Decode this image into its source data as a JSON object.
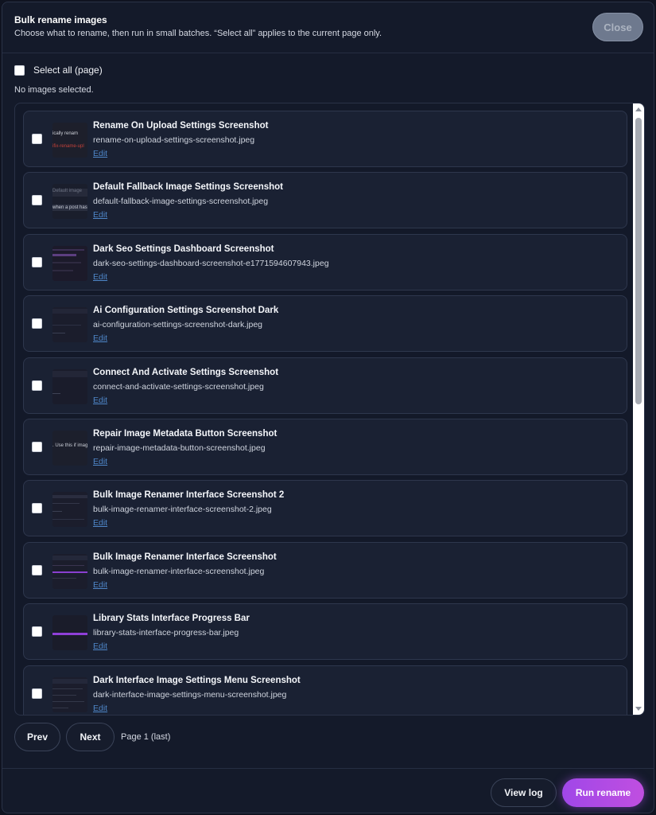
{
  "header": {
    "title": "Bulk rename images",
    "subtitle": "Choose what to rename, then run in small batches. “Select all” applies to the current page only.",
    "close_label": "Close"
  },
  "select_all": {
    "label": "Select all (page)",
    "checked": false
  },
  "selection_status": "No images selected.",
  "items": [
    {
      "title": "Rename On Upload Settings Screenshot",
      "filename": "rename-on-upload-settings-screenshot.jpeg",
      "edit": "Edit",
      "thumb_line1": "ically renam",
      "thumb_line2": "ifix-rename-upl",
      "checked": false
    },
    {
      "title": "Default Fallback Image Settings Screenshot",
      "filename": "default-fallback-image-settings-screenshot.jpeg",
      "edit": "Edit",
      "thumb_line1": "Default image",
      "thumb_line2": "when a post has no",
      "checked": false
    },
    {
      "title": "Dark Seo Settings Dashboard Screenshot",
      "filename": "dark-seo-settings-dashboard-screenshot-e1771594607943.jpeg",
      "edit": "Edit",
      "checked": false
    },
    {
      "title": "Ai Configuration Settings Screenshot Dark",
      "filename": "ai-configuration-settings-screenshot-dark.jpeg",
      "edit": "Edit",
      "checked": false
    },
    {
      "title": "Connect And Activate Settings Screenshot",
      "filename": "connect-and-activate-settings-screenshot.jpeg",
      "edit": "Edit",
      "checked": false
    },
    {
      "title": "Repair Image Metadata Button Screenshot",
      "filename": "repair-image-metadata-button-screenshot.jpeg",
      "edit": "Edit",
      "thumb_line1": ". Use this if images ap",
      "checked": false
    },
    {
      "title": "Bulk Image Renamer Interface Screenshot 2",
      "filename": "bulk-image-renamer-interface-screenshot-2.jpeg",
      "edit": "Edit",
      "checked": false
    },
    {
      "title": "Bulk Image Renamer Interface Screenshot",
      "filename": "bulk-image-renamer-interface-screenshot.jpeg",
      "edit": "Edit",
      "checked": false
    },
    {
      "title": "Library Stats Interface Progress Bar",
      "filename": "library-stats-interface-progress-bar.jpeg",
      "edit": "Edit",
      "checked": false
    },
    {
      "title": "Dark Interface Image Settings Menu Screenshot",
      "filename": "dark-interface-image-settings-menu-screenshot.jpeg",
      "edit": "Edit",
      "checked": false
    }
  ],
  "pagination": {
    "prev_label": "Prev",
    "next_label": "Next",
    "page_label": "Page 1 (last)"
  },
  "footer": {
    "view_log_label": "View log",
    "run_label": "Run rename"
  },
  "colors": {
    "accent": "#b04ce6",
    "link": "#4e86c8",
    "background": "#141a2a"
  }
}
